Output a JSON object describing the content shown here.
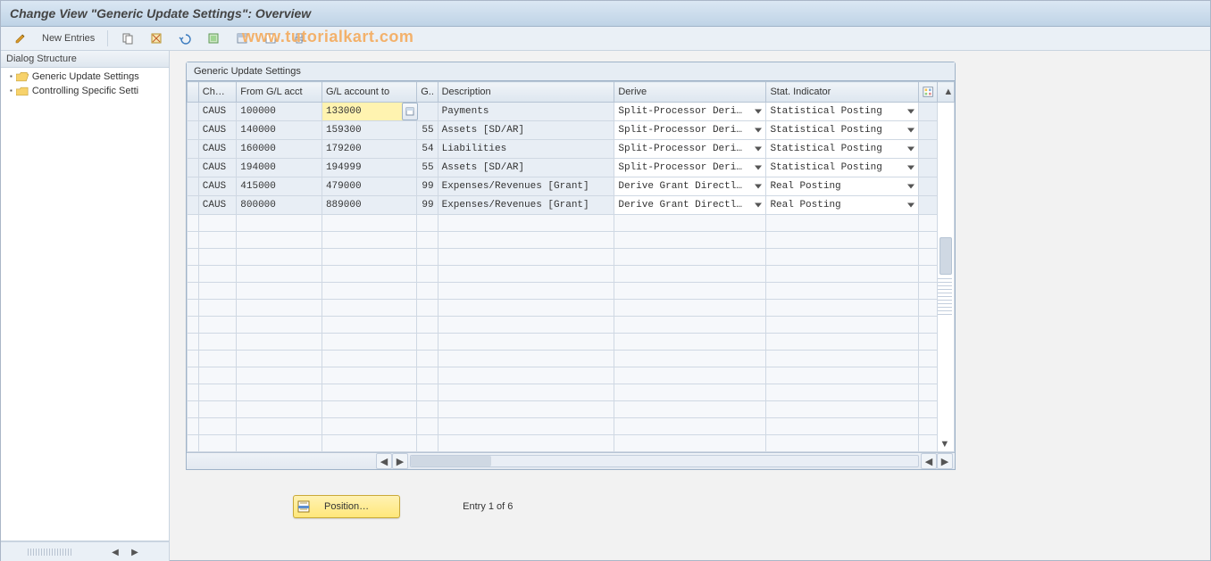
{
  "title": "Change View \"Generic Update Settings\": Overview",
  "toolbar": {
    "new_entries_label": "New Entries"
  },
  "watermark": {
    "text": "www.tutorialkart.com",
    "color": "#f3b16b"
  },
  "sidebar": {
    "header": "Dialog Structure",
    "items": [
      {
        "label": "Generic Update Settings",
        "open": true,
        "selected": true
      },
      {
        "label": "Controlling Specific Setti",
        "open": false,
        "selected": false
      }
    ]
  },
  "grid": {
    "title": "Generic Update Settings",
    "columns": {
      "ch": "Ch…",
      "from": "From G/L acct",
      "to": "G/L account to",
      "g": "G..",
      "desc": "Description",
      "derive": "Derive",
      "stat": "Stat. Indicator"
    },
    "rows": [
      {
        "ch": "CAUS",
        "from": "100000",
        "to": "133000",
        "g": "",
        "desc": "Payments",
        "derive": "Split-Processor Deri…",
        "stat": "Statistical Posting",
        "active_to": true
      },
      {
        "ch": "CAUS",
        "from": "140000",
        "to": "159300",
        "g": "55",
        "desc": "Assets [SD/AR]",
        "derive": "Split-Processor Deri…",
        "stat": "Statistical Posting"
      },
      {
        "ch": "CAUS",
        "from": "160000",
        "to": "179200",
        "g": "54",
        "desc": "Liabilities",
        "derive": "Split-Processor Deri…",
        "stat": "Statistical Posting"
      },
      {
        "ch": "CAUS",
        "from": "194000",
        "to": "194999",
        "g": "55",
        "desc": "Assets [SD/AR]",
        "derive": "Split-Processor Deri…",
        "stat": "Statistical Posting"
      },
      {
        "ch": "CAUS",
        "from": "415000",
        "to": "479000",
        "g": "99",
        "desc": "Expenses/Revenues [Grant]",
        "derive": "Derive Grant Directl…",
        "stat": "Real Posting"
      },
      {
        "ch": "CAUS",
        "from": "800000",
        "to": "889000",
        "g": "99",
        "desc": "Expenses/Revenues [Grant]",
        "derive": "Derive Grant Directl…",
        "stat": "Real Posting"
      }
    ],
    "empty_rows": 14
  },
  "footer": {
    "position_label": "Position…",
    "entry_text": "Entry 1 of 6"
  }
}
